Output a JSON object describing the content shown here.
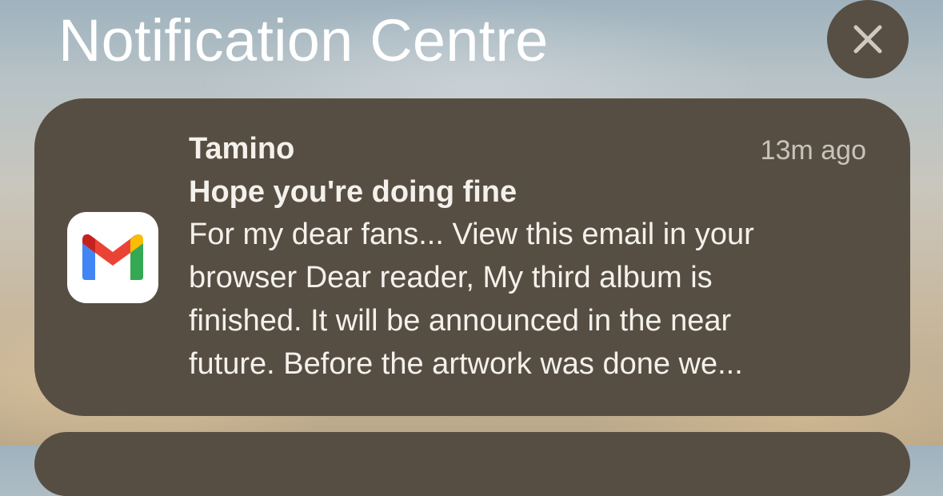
{
  "header": {
    "title": "Notification Centre",
    "close_icon": "close-icon"
  },
  "notification": {
    "app_icon": "gmail-icon",
    "sender": "Tamino",
    "time": "13m ago",
    "subject": "Hope you're doing fine",
    "body_lines": [
      "For my dear fans... View this email in your",
      "browser Dear reader, My third album is",
      "finished. It will be announced in the near",
      "future. Before the artwork was done we..."
    ]
  },
  "colors": {
    "card_background": "#574e43",
    "close_button_background": "#574e44",
    "text_primary": "#f4f1ec",
    "text_secondary": "#c9c3ba"
  }
}
